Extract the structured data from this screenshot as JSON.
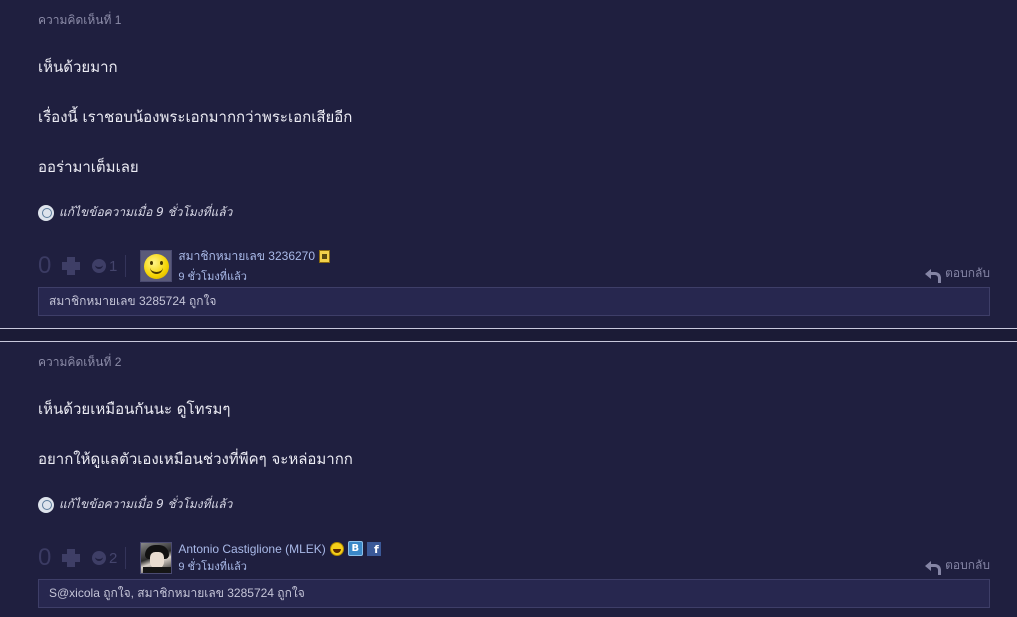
{
  "comments": [
    {
      "label": "ความคิดเห็นที่ 1",
      "lines": [
        "เห็นด้วยมาก",
        "เรื่องนี้ เราชอบน้องพระเอกมากกว่าพระเอกเสียอีก",
        "ออร่ามาเต็มเลย"
      ],
      "edit_note": "แก้ไขข้อความเมื่อ 9 ชั่วโมงที่แล้ว",
      "vote_count": "0",
      "emotion_count": "1",
      "user_name": "สมาชิกหมายเลข 3236270",
      "time": "9 ชั่วโมงที่แล้ว",
      "reply_label": "ตอบกลับ",
      "likes": "สมาชิกหมายเลข 3285724 ถูกใจ"
    },
    {
      "label": "ความคิดเห็นที่ 2",
      "lines": [
        "เห็นด้วยเหมือนกันนะ  ดูโทรมๆ",
        "อยากให้ดูแลตัวเองเหมือนช่วงที่พีคๆ จะหล่อมากก"
      ],
      "edit_note": "แก้ไขข้อความเมื่อ 9 ชั่วโมงที่แล้ว",
      "vote_count": "0",
      "emotion_count": "2",
      "user_name": "Antonio Castiglione (MLEK)",
      "time": "9 ชั่วโมงที่แล้ว",
      "reply_label": "ตอบกลับ",
      "likes": "S@xicola ถูกใจ, สมาชิกหมายเลข 3285724 ถูกใจ",
      "blog_badge": "B",
      "fb_badge": "f"
    }
  ],
  "icons": {
    "edit": "edit-history-icon",
    "plus": "plus-vote-icon",
    "emotion": "emotion-icon",
    "reply": "reply-arrow-icon"
  },
  "colors": {
    "background": "#1f1f3f",
    "link": "#a9b9e8",
    "muted": "#8c8ca8"
  }
}
